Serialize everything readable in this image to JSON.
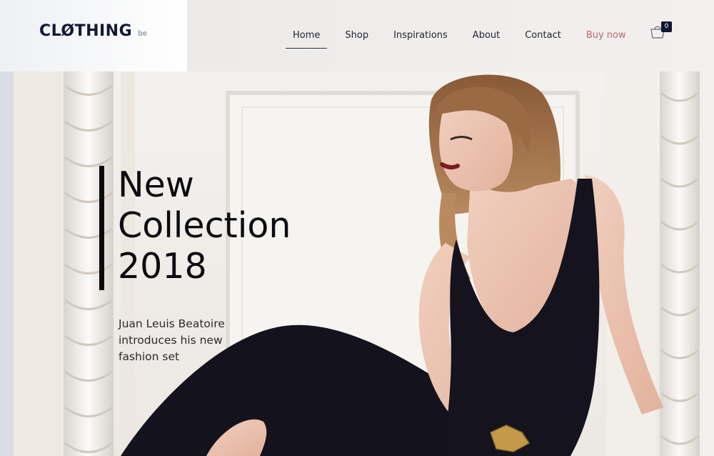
{
  "brand": {
    "name": "CLØTHING",
    "suffix": "be"
  },
  "nav": {
    "items": [
      {
        "label": "Home"
      },
      {
        "label": "Shop"
      },
      {
        "label": "Inspirations"
      },
      {
        "label": "About"
      },
      {
        "label": "Contact"
      },
      {
        "label": "Buy now"
      }
    ],
    "active": "Home"
  },
  "cart": {
    "count": "0",
    "icon": "shopping-bag-icon"
  },
  "hero": {
    "title_line1": "New",
    "title_line2": "Collection",
    "title_line3": "2018",
    "subtitle": "Juan Leuis Beatoire introduces his new fashion set"
  },
  "colors": {
    "brand_navy": "#121a33",
    "buy_now": "#b7676b",
    "title": "#0c0c10"
  }
}
